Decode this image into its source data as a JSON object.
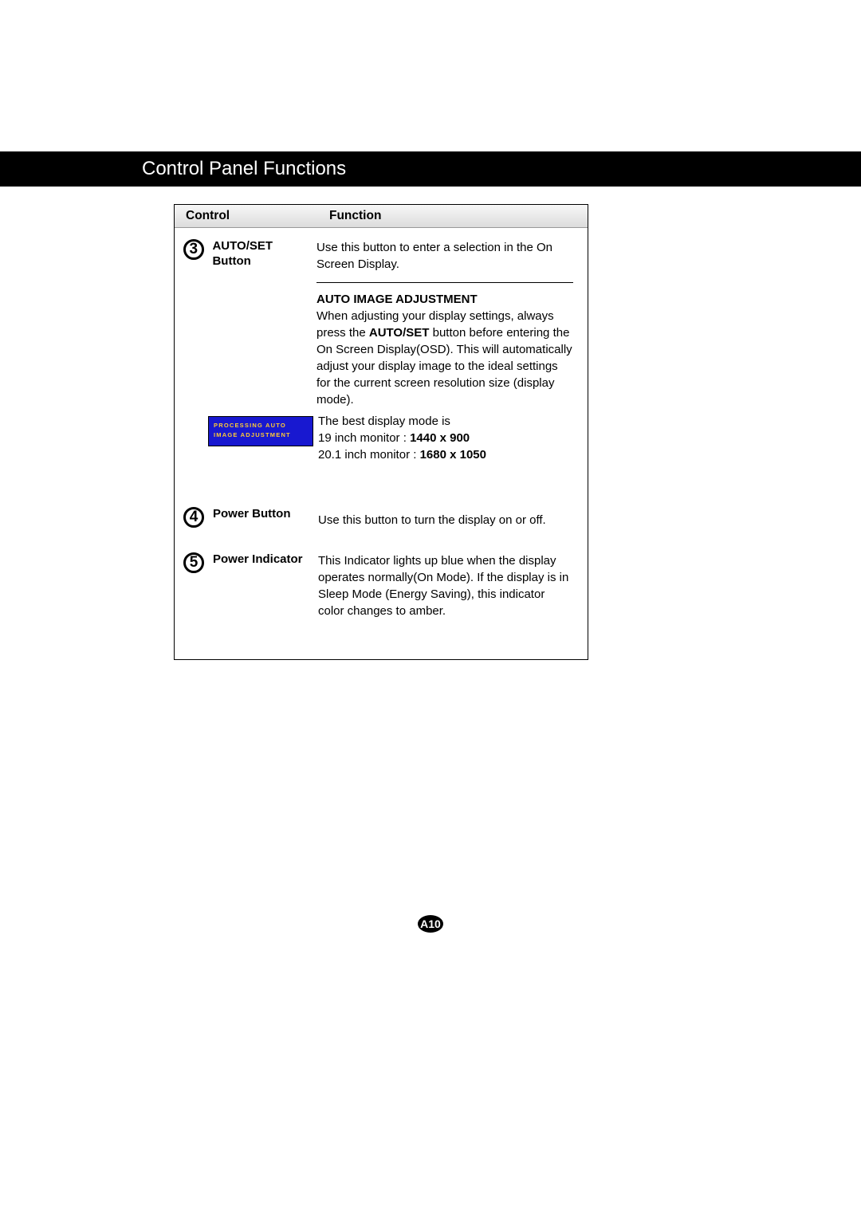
{
  "title": "Control Panel Functions",
  "header": {
    "control": "Control",
    "function": "Function"
  },
  "row3": {
    "num": "3",
    "name_l1": "AUTO/SET",
    "name_l2": "Button",
    "func_intro": "Use this button to enter a selection in the On Screen Display.",
    "sub_head": "AUTO IMAGE ADJUSTMENT",
    "sub_p1a": "When adjusting your display settings, always press the ",
    "sub_p1b": "AUTO/SET",
    "sub_p1c": " button before entering the On Screen Display(OSD). This will automatically adjust your display image to the ideal settings for the current screen resolution size (display mode).",
    "osd_l1": "PROCESSING AUTO",
    "osd_l2": "IMAGE ADJUSTMENT",
    "best_intro": "The best display mode is",
    "mode1_pre": "19 inch monitor : ",
    "mode1_val": "1440 x 900",
    "mode2_pre": "20.1 inch monitor : ",
    "mode2_val": "1680 x 1050"
  },
  "row4": {
    "num": "4",
    "name": "Power Button",
    "func": "Use this button to turn the display on or off."
  },
  "row5": {
    "num": "5",
    "name": "Power Indicator",
    "func": "This Indicator lights up blue when the display operates normally(On Mode). If the display is in Sleep Mode (Energy Saving), this indicator color changes to amber."
  },
  "page_num": "A10"
}
